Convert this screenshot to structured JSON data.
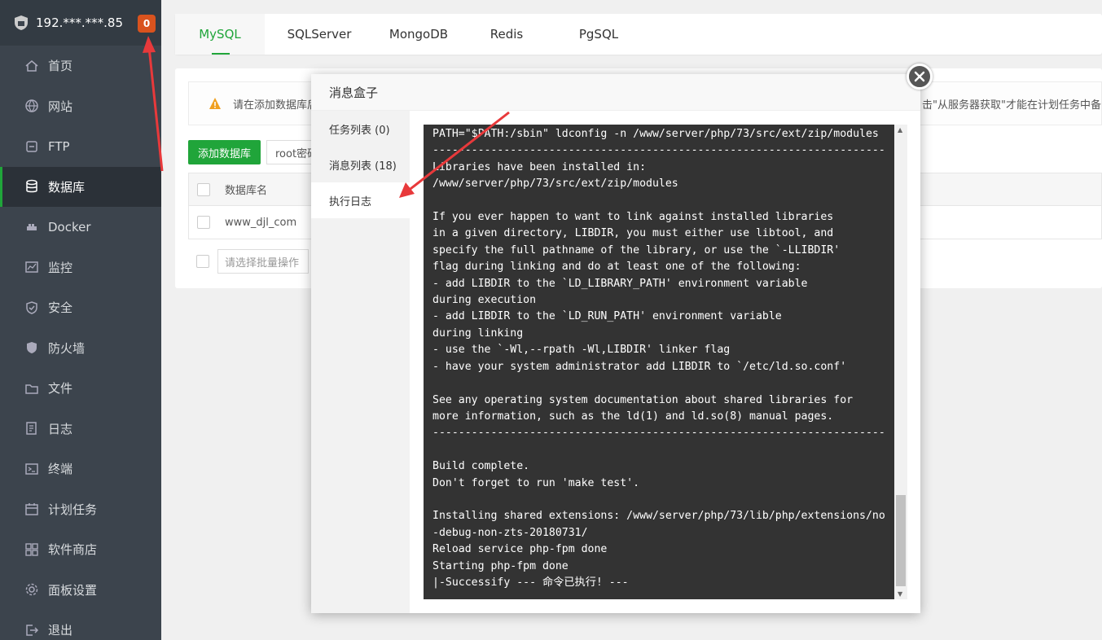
{
  "sidebar": {
    "ip": "192.***.***.85",
    "badge": "0",
    "items": [
      {
        "label": "首页",
        "icon": "home-icon"
      },
      {
        "label": "网站",
        "icon": "globe-icon"
      },
      {
        "label": "FTP",
        "icon": "ftp-icon"
      },
      {
        "label": "数据库",
        "icon": "database-icon",
        "active": true
      },
      {
        "label": "Docker",
        "icon": "docker-icon"
      },
      {
        "label": "监控",
        "icon": "monitor-icon"
      },
      {
        "label": "安全",
        "icon": "shield-check-icon"
      },
      {
        "label": "防火墙",
        "icon": "firewall-shield-icon"
      },
      {
        "label": "文件",
        "icon": "folder-icon"
      },
      {
        "label": "日志",
        "icon": "log-icon"
      },
      {
        "label": "终端",
        "icon": "terminal-icon"
      },
      {
        "label": "计划任务",
        "icon": "calendar-icon"
      },
      {
        "label": "软件商店",
        "icon": "apps-grid-icon"
      },
      {
        "label": "面板设置",
        "icon": "gear-icon"
      },
      {
        "label": "退出",
        "icon": "logout-icon"
      }
    ]
  },
  "tabs": [
    "MySQL",
    "SQLServer",
    "MongoDB",
    "Redis",
    "PgSQL"
  ],
  "notice": {
    "text": "请在添加数据库后，",
    "tail": "击\"从服务器获取\"才能在计划任务中备"
  },
  "toolbar": {
    "add_db": "添加数据库",
    "root_pwd": "root密码"
  },
  "table": {
    "header": "数据库名",
    "rows": [
      "www_djl_com"
    ]
  },
  "batch": {
    "placeholder": "请选择批量操作"
  },
  "modal": {
    "title": "消息盒子",
    "menu": [
      {
        "label": "任务列表 (0)"
      },
      {
        "label": "消息列表 (18)"
      },
      {
        "label": "执行日志",
        "active": true
      }
    ],
    "log": "PATH=\"$PATH:/sbin\" ldconfig -n /www/server/php/73/src/ext/zip/modules\n----------------------------------------------------------------------\nLibraries have been installed in:\n/www/server/php/73/src/ext/zip/modules\n\nIf you ever happen to want to link against installed libraries\nin a given directory, LIBDIR, you must either use libtool, and\nspecify the full pathname of the library, or use the `-LLIBDIR'\nflag during linking and do at least one of the following:\n- add LIBDIR to the `LD_LIBRARY_PATH' environment variable\nduring execution\n- add LIBDIR to the `LD_RUN_PATH' environment variable\nduring linking\n- use the `-Wl,--rpath -Wl,LIBDIR' linker flag\n- have your system administrator add LIBDIR to `/etc/ld.so.conf'\n\nSee any operating system documentation about shared libraries for\nmore information, such as the ld(1) and ld.so(8) manual pages.\n----------------------------------------------------------------------\n\nBuild complete.\nDon't forget to run 'make test'.\n\nInstalling shared extensions: /www/server/php/73/lib/php/extensions/no\n-debug-non-zts-20180731/\nReload service php-fpm done\nStarting php-fpm done\n|-Successify --- 命令已执行! ---"
  },
  "colors": {
    "accent": "#20a53a",
    "sidebar_bg": "#3c444d",
    "badge": "#d9531e",
    "console_bg": "#333333",
    "annotation_arrow": "#e8393b"
  }
}
